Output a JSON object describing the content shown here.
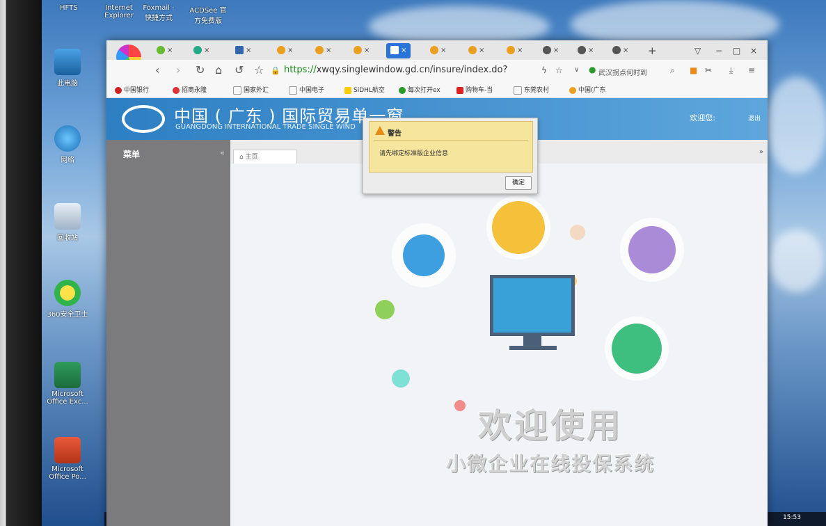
{
  "desktop": {
    "top_labels": [
      "HFTS",
      "Internet Explorer",
      "Foxmail - 快捷方式",
      "ACDSee 官方免费版"
    ],
    "icons": [
      {
        "label": "此电脑",
        "icon": "computer-icon"
      },
      {
        "label": "网络",
        "icon": "network-icon"
      },
      {
        "label": "回收站",
        "icon": "recycle-bin-icon"
      },
      {
        "label": "360安全卫士",
        "icon": "360-safe-icon"
      },
      {
        "label": "Microsoft Office Exc...",
        "icon": "excel-icon"
      },
      {
        "label": "Microsoft Office Po...",
        "icon": "powerpoint-icon"
      }
    ],
    "clock": "15:53"
  },
  "browser": {
    "url_scheme": "https://",
    "url_rest": "xwqy.singlewindow.gd.cn/insure/index.do?isRedir",
    "search_text": "武汉拐点何时到",
    "bookmarks": [
      "中国银行",
      "招商永隆",
      "国家外汇",
      "中国电子",
      "SiDHL航空",
      "每次打开ex",
      "购物车-当",
      "东莞农村",
      "中国(广东"
    ],
    "tab_count": 14
  },
  "site": {
    "title": "中国 ( 广东 ) 国际贸易单一窗",
    "subtitle": "GUANGDONG INTERNATIONAL TRADE SINGLE WIND",
    "welcome": "欢迎您:",
    "logout": "退出",
    "menu_title": "菜单",
    "collapse_symbol": "«",
    "home_tab": "主页",
    "hero_title": "欢迎使用",
    "hero_subtitle": "小微企业在线投保系统"
  },
  "dialog": {
    "title": "警告",
    "message": "请先绑定标准版企业信息",
    "ok": "确定"
  },
  "colors": {
    "header_blue": "#2d7fc3",
    "sidebar_gray": "#7b7b7d",
    "dialog_yellow": "#f6e59c",
    "tab_active": "#2a74d8"
  }
}
